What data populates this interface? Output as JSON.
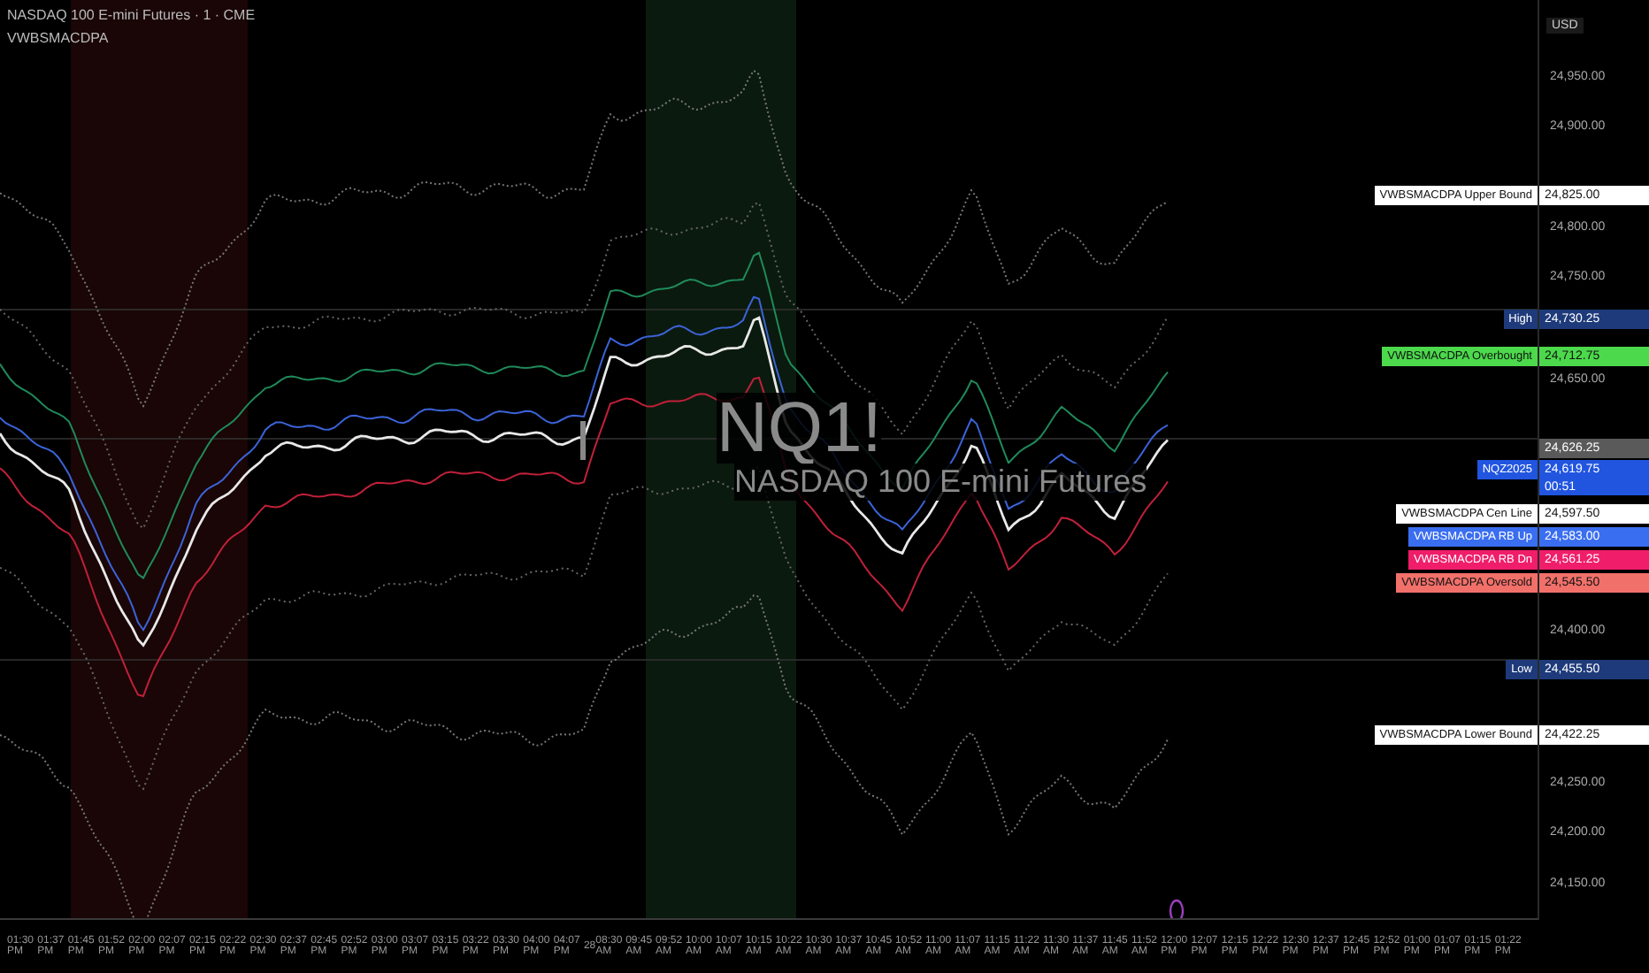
{
  "legend": {
    "symbol": "NASDAQ 100 E-mini Futures · 1 · CME",
    "indicator": "VWBSMACDPA"
  },
  "watermark": {
    "ticker": "NQ1!",
    "name": "NASDAQ 100 E-mini Futures"
  },
  "price_axis": {
    "currency": "USD",
    "ticks": [
      "24,950.00",
      "24,900.00",
      "24,800.00",
      "24,750.00",
      "24,650.00",
      "24,400.00",
      "24,250.00",
      "24,200.00",
      "24,150.00"
    ]
  },
  "badges": [
    {
      "label": "VWBSMACDPA Upper Bound",
      "value": "24,825.00",
      "color": "#ffffff"
    },
    {
      "label": "High",
      "value": "24,730.25",
      "color": "#1e3a7a"
    },
    {
      "label": "VWBSMACDPA Overbought",
      "value": "24,712.75",
      "color": "#4cd94c"
    },
    {
      "value": "24,626.25",
      "color": "#5a5a5a"
    },
    {
      "label": "NQZ2025",
      "value": "24,619.75",
      "countdown": "00:51",
      "color": "#2155e0"
    },
    {
      "label": "VWBSMACDPA Cen Line",
      "value": "24,597.50",
      "color": "#ffffff"
    },
    {
      "label": "VWBSMACDPA RB Up",
      "value": "24,583.00",
      "color": "#3a6ef0"
    },
    {
      "label": "VWBSMACDPA RB Dn",
      "value": "24,561.25",
      "color": "#f01d6a"
    },
    {
      "label": "VWBSMACDPA Oversold",
      "value": "24,545.50",
      "color": "#f2706a"
    },
    {
      "label": "Low",
      "value": "24,455.50",
      "color": "#1e3a7a"
    },
    {
      "label": "VWBSMACDPA Lower Bound",
      "value": "24,422.25",
      "color": "#ffffff"
    }
  ],
  "time_axis": [
    "01:30 PM",
    "01:37 PM",
    "01:45 PM",
    "01:52 PM",
    "02:00 PM",
    "02:07 PM",
    "02:15 PM",
    "02:22 PM",
    "02:30 PM",
    "02:37 PM",
    "02:45 PM",
    "02:52 PM",
    "03:00 PM",
    "03:07 PM",
    "03:15 PM",
    "03:22 PM",
    "03:30 PM",
    "04:00 PM",
    "04:07 PM",
    "28",
    "08:30 AM",
    "09:45 AM",
    "09:52 AM",
    "10:00 AM",
    "10:07 AM",
    "10:15 AM",
    "10:22 AM",
    "10:30 AM",
    "10:37 AM",
    "10:45 AM",
    "10:52 AM",
    "11:00 AM",
    "11:07 AM",
    "11:15 AM",
    "11:22 AM",
    "11:30 AM",
    "11:37 AM",
    "11:45 AM",
    "11:52 AM",
    "12:00 PM",
    "12:07 PM",
    "12:15 PM",
    "12:22 PM",
    "12:30 PM",
    "12:37 PM",
    "12:45 PM",
    "12:52 PM",
    "01:00 PM",
    "01:07 PM",
    "01:15 PM",
    "01:22 PM"
  ]
}
